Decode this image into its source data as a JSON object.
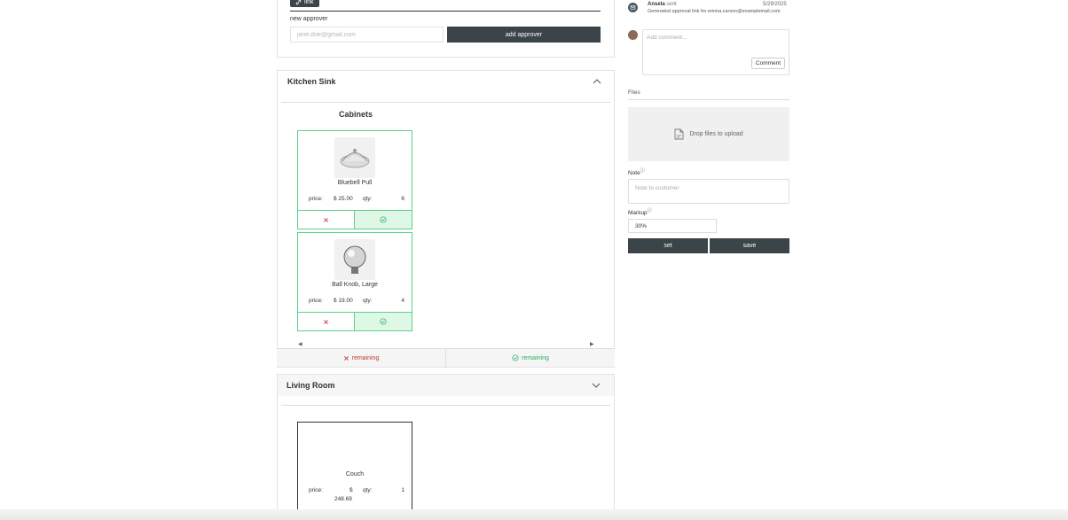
{
  "approvers": {
    "link_label": "link",
    "new_approver_label": "new approver",
    "email_placeholder": "jane.doe@gmail.com",
    "add_button": "add approver"
  },
  "rooms": [
    {
      "title": "Kitchen Sink",
      "expanded": true,
      "section": "Cabinets",
      "products": [
        {
          "name": "Bluebell Pull",
          "price_label": "price:",
          "price": "$ 25.00",
          "qty_label": "qty:",
          "qty": "6"
        },
        {
          "name": "Ball Knob, Large",
          "price_label": "price:",
          "price": "$ 19.00",
          "qty_label": "qty:",
          "qty": "4"
        }
      ],
      "remaining_rejected": "remaining",
      "remaining_approved": "remaining"
    },
    {
      "title": "Living Room",
      "expanded": false,
      "products": [
        {
          "name": "Couch",
          "price_label": "price:",
          "price_sym": "$",
          "price_val": "248.69",
          "qty_label": "qty:",
          "qty": "1"
        }
      ]
    }
  ],
  "activity": {
    "name": "Ansela",
    "action": "sent",
    "date": "5/29/2025",
    "message": "Generated approval link for emma.carson@examplemail.com"
  },
  "comment": {
    "placeholder": "Add comment...",
    "button": "Comment"
  },
  "files": {
    "label": "Files",
    "drop_text": "Drop files to upload"
  },
  "note": {
    "label": "Note",
    "placeholder": "Note to customer"
  },
  "markup": {
    "label": "Markup",
    "value": "30%",
    "set_button": "set",
    "save_button": "save"
  },
  "colors": {
    "dark_button": "#3a4449",
    "approved_green": "#5bd38c",
    "approved_bg": "#dff8e6",
    "reject_red": "#c0392b"
  }
}
